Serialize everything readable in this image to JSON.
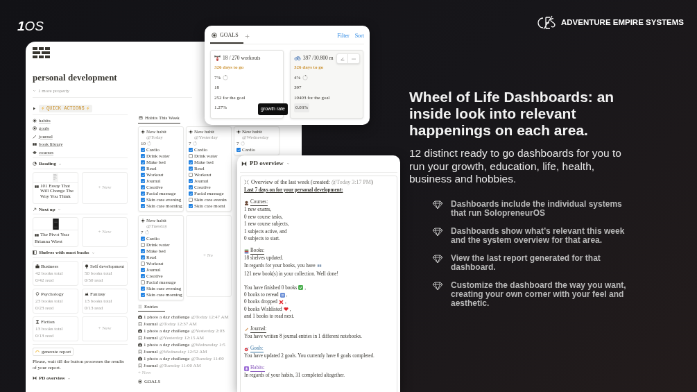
{
  "brand": {
    "mark": "**1**OS",
    "company": "ADVENTURE EMPIRE SYSTEMS"
  },
  "page": {
    "title": "personal development",
    "more": "1 more property",
    "quick_actions": "QUICK ACTIONS",
    "links": [
      "habits",
      "goals",
      "journal",
      "book library",
      "courses"
    ],
    "reading": {
      "label": "Reading",
      "book": {
        "title": "101 Essay That Will Change The Way You Think"
      },
      "new": "+ New"
    },
    "next_up": {
      "label": "Next up",
      "book": {
        "title": "The Pivot Year",
        "author": "Brianna Wiest"
      },
      "new": "+ New"
    },
    "shelves": {
      "label": "Shelves with most books",
      "items": [
        {
          "name": "Business",
          "total": "42 books total",
          "read": "0/42 read"
        },
        {
          "name": "Self development",
          "total": "50 books total",
          "read": "0/50 read"
        },
        {
          "name": "Psychology",
          "total": "23 books total",
          "read": "0/23 read"
        },
        {
          "name": "Fantasy",
          "total": "13 books total",
          "read": "0/13 read"
        },
        {
          "name": "Fiction",
          "total": "13 books total",
          "read": "0/13 read"
        }
      ],
      "new": "+ New"
    },
    "report_button": "generate report",
    "report_note": "Please, wait till the button processes the results of your report.",
    "bottom_label": "PD overview",
    "habits": {
      "tab": "Habits This Week",
      "cards": [
        {
          "title": "New habit",
          "date": "@Today",
          "count": "10",
          "items": [
            {
              "label": "Cardio",
              "checked": true
            },
            {
              "label": "Drink water",
              "checked": true
            },
            {
              "label": "Make bed",
              "checked": true
            },
            {
              "label": "Read",
              "checked": true
            },
            {
              "label": "Workout",
              "checked": true
            },
            {
              "label": "Journal",
              "checked": true
            },
            {
              "label": "Creative",
              "checked": true
            },
            {
              "label": "Facial massage",
              "checked": true
            },
            {
              "label": "Skin care evening",
              "checked": true
            },
            {
              "label": "Skin care morning",
              "checked": true
            }
          ]
        },
        {
          "title": "New habit",
          "date": "@Yesterday",
          "count": "7",
          "items": [
            {
              "label": "Cardio",
              "checked": true
            },
            {
              "label": "Drink water",
              "checked": false
            },
            {
              "label": "Make bed",
              "checked": true
            },
            {
              "label": "Read",
              "checked": true
            },
            {
              "label": "Workout",
              "checked": false
            },
            {
              "label": "Journal",
              "checked": true
            },
            {
              "label": "Creative",
              "checked": true
            },
            {
              "label": "Facial massage",
              "checked": true
            },
            {
              "label": "Skin care evenin",
              "checked": false
            },
            {
              "label": "Skin care morni",
              "checked": true
            }
          ]
        },
        {
          "title": "New habit",
          "date": "@Wednesday",
          "count": "7",
          "items": [
            {
              "label": "Cardio",
              "checked": true
            }
          ]
        },
        {
          "title": "New habit",
          "date": "@Tuesday",
          "count": "7",
          "items": [
            {
              "label": "Cardio",
              "checked": true
            },
            {
              "label": "Drink water",
              "checked": false
            },
            {
              "label": "Make bed",
              "checked": true
            },
            {
              "label": "Read",
              "checked": true
            },
            {
              "label": "Workout",
              "checked": false
            },
            {
              "label": "Journal",
              "checked": true
            },
            {
              "label": "Creative",
              "checked": true
            },
            {
              "label": "Facial massage",
              "checked": false
            },
            {
              "label": "Skin care evening",
              "checked": true
            },
            {
              "label": "Skin care morning",
              "checked": true
            }
          ]
        }
      ],
      "new": "+ Ne"
    },
    "entries": {
      "tab": "Entries",
      "items": [
        {
          "kind": "photo",
          "title": "1 photo a day challenge",
          "date": "@Today 12:47 AM"
        },
        {
          "kind": "journal",
          "title": "Journal",
          "date": "@Today 12:37 AM"
        },
        {
          "kind": "photo",
          "title": "1 photo a day challenge",
          "date": "@Yesterday 2:03"
        },
        {
          "kind": "journal",
          "title": "Journal",
          "date": "@Yesterday 12:15 AM"
        },
        {
          "kind": "photo",
          "title": "1 photo a day challenge",
          "date": "@Wednesday 1:5"
        },
        {
          "kind": "journal",
          "title": "Journal",
          "date": "@Wednesday 12:52 AM"
        },
        {
          "kind": "photo",
          "title": "1 photo a day challenge",
          "date": "@Tuesday 11:00"
        },
        {
          "kind": "journal",
          "title": "Journal",
          "date": "@Tuesday 11:00 AM"
        }
      ],
      "new": "+ New"
    },
    "goals_label": "GOALS"
  },
  "goals": {
    "tab": "GOALS",
    "actions": [
      "Filter",
      "Sort"
    ],
    "tooltip": "growth rate",
    "cards": [
      {
        "title": "18 / 270 workouts",
        "days": "326 days to go",
        "percent": "7%",
        "count": "18",
        "remaining": "252 for the goal",
        "rate": "1.27%",
        "hovered": false
      },
      {
        "title": "397 /10.800 m",
        "days": "326 days to go",
        "percent": "4%",
        "count": "397",
        "remaining": "10403 for the goal",
        "rate": "0.03%",
        "hovered": true
      }
    ]
  },
  "overview": {
    "title": "PD overview",
    "lead": "Overview of the last week (created:",
    "date": "@Today 3:17 PM",
    "tail": ")",
    "summary": "Last 7 days on for your personal development:",
    "sections": [
      {
        "heading": "Courses:",
        "color": "#37352f",
        "paragraphs": [
          [
            {
              "kind": "plain",
              "text": "1 new exams,"
            },
            {
              "kind": "plain",
              "text": "0 new course tasks,"
            },
            {
              "kind": "plain",
              "text": "1 new course subjects,"
            },
            {
              "kind": "plain",
              "text": "1 subjects active, and"
            },
            {
              "kind": "plain",
              "text": "0 subjects to start."
            }
          ]
        ]
      },
      {
        "heading": "Books:",
        "color": "#37352f",
        "paragraphs": [
          [
            {
              "kind": "plain",
              "text": "18 shelves updated."
            },
            {
              "kind": "icon",
              "text": "In regards for your books, you have",
              "after": "121 new book(s) in your collection. Well done!"
            }
          ],
          [
            {
              "kind": "icon",
              "text": "You have finished 0 books",
              "after": ","
            },
            {
              "kind": "icon",
              "text": "0 books to reread",
              "after": ","
            },
            {
              "kind": "icon",
              "text": "0 books dropped",
              "after": ","
            },
            {
              "kind": "icon",
              "text": "0 books Wishlisted",
              "after": ","
            },
            {
              "kind": "plain",
              "text": "and 1 books to read next."
            }
          ]
        ]
      },
      {
        "heading": "Journal:",
        "color": "#37352f",
        "paragraphs": [
          [
            {
              "kind": "plain",
              "text": "You have written 8 journal entries in 1 different notebooks."
            }
          ]
        ]
      },
      {
        "heading": "Goals:",
        "color": "#2f6f9f",
        "paragraphs": [
          [
            {
              "kind": "plain",
              "text": "You have updated 2 goals. You currently have 0 goals completed."
            }
          ]
        ]
      },
      {
        "heading": "Habits:",
        "color": "#8a5bbd",
        "paragraphs": [
          [
            {
              "kind": "plain",
              "text": "In regards of your habits, 31 completed altogether."
            }
          ]
        ]
      }
    ]
  },
  "promo": {
    "title": "Wheel of Life Dashboards: an inside look into relevant happenings on each area.",
    "subtitle": "12 distinct ready to go dashboards for you to run your growth, education, life, health, business and hobbies.",
    "points": [
      "Dashboards include the individual systems that run SolopreneurOS",
      "Dashboards show what’s relevant this week and the system overview for that area.",
      "View the last report generated for that dashboard.",
      "Customize the dashboard the way you want, creating your own corner with your feel and aesthetic."
    ]
  }
}
